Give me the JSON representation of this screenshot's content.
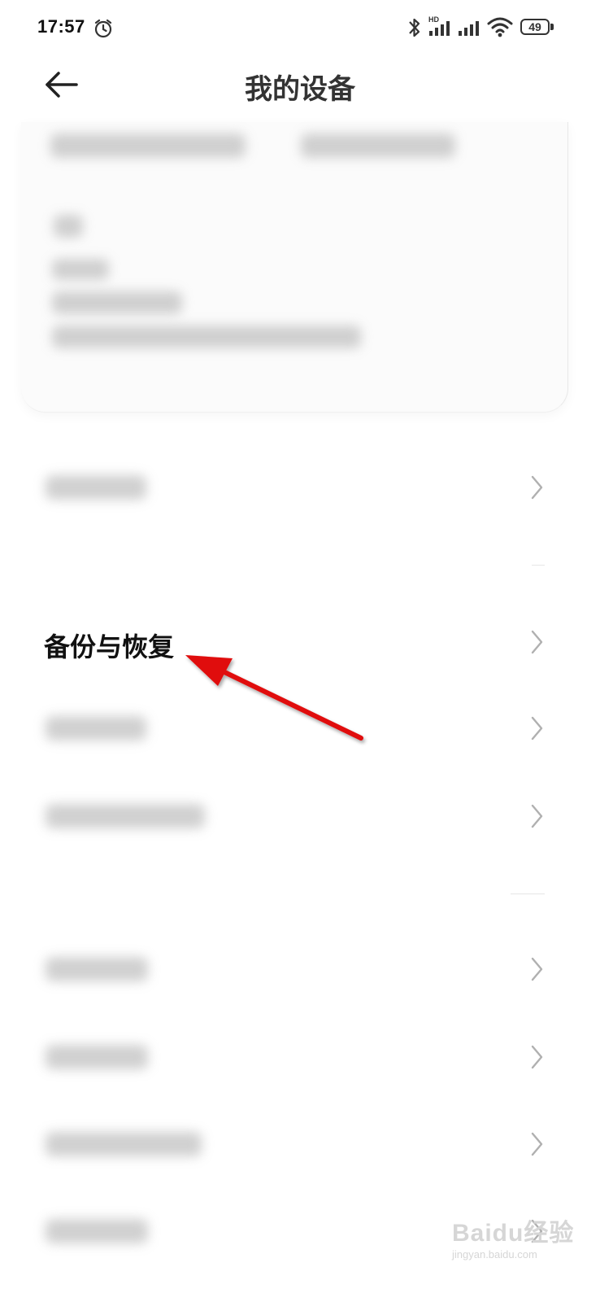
{
  "status_bar": {
    "time": "17:57",
    "battery": "49",
    "icons": [
      "alarm-icon",
      "bluetooth-icon",
      "signal-hd-icon",
      "signal-icon",
      "wifi-icon",
      "battery-icon"
    ]
  },
  "header": {
    "title": "我的设备",
    "back_icon": "back-arrow-icon"
  },
  "device_card": {
    "blurred": true
  },
  "settings_rows": [
    {
      "label": "",
      "blurred": true
    },
    {
      "label": "备份与恢复",
      "blurred": false,
      "highlighted": true
    },
    {
      "label": "",
      "blurred": true
    },
    {
      "label": "",
      "blurred": true
    },
    {
      "label": "",
      "blurred": true
    },
    {
      "label": "",
      "blurred": true
    },
    {
      "label": "",
      "blurred": true
    },
    {
      "label": "",
      "blurred": true
    }
  ],
  "annotation": {
    "arrow_color": "#e01010",
    "points_to": "备份与恢复"
  },
  "watermark": {
    "text": "Baidu经验",
    "sub": "jingyan.baidu.com"
  },
  "colors": {
    "background": "#ffffff",
    "chevron": "#b0b0b0",
    "arrow": "#e01010"
  }
}
